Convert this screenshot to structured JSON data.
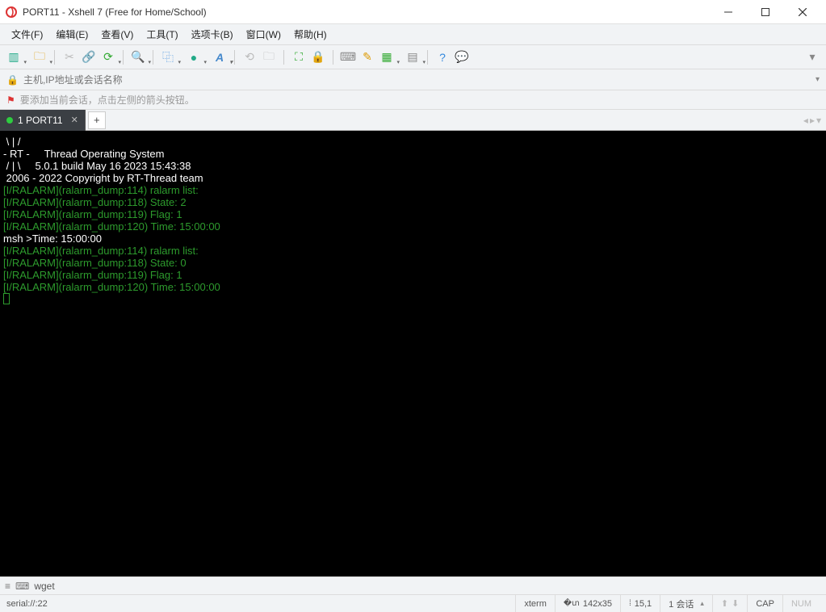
{
  "window": {
    "title": "PORT11 - Xshell 7 (Free for Home/School)"
  },
  "menu": {
    "file": "文件(F)",
    "edit": "编辑(E)",
    "view": "查看(V)",
    "tools": "工具(T)",
    "tabs": "选项卡(B)",
    "window": "窗口(W)",
    "help": "帮助(H)"
  },
  "addressbar": {
    "placeholder": "主机,IP地址或会话名称"
  },
  "hint": {
    "text": "要添加当前会话，点击左侧的箭头按钮。"
  },
  "tab": {
    "label": "1 PORT11"
  },
  "terminal": {
    "lines": [
      {
        "cls": "",
        "text": " \\ | /"
      },
      {
        "cls": "",
        "text": "- RT -     Thread Operating System"
      },
      {
        "cls": "",
        "text": " / | \\     5.0.1 build May 16 2023 15:43:38"
      },
      {
        "cls": "",
        "text": " 2006 - 2022 Copyright by RT-Thread team"
      },
      {
        "cls": "g",
        "text": "[I/RALARM](ralarm_dump:114) ralarm list:"
      },
      {
        "cls": "g",
        "text": "[I/RALARM](ralarm_dump:118) State: 2"
      },
      {
        "cls": "g",
        "text": "[I/RALARM](ralarm_dump:119) Flag: 1"
      },
      {
        "cls": "g",
        "text": "[I/RALARM](ralarm_dump:120) Time: 15:00:00"
      },
      {
        "cls": "",
        "text": "msh >Time: 15:00:00"
      },
      {
        "cls": "g",
        "text": "[I/RALARM](ralarm_dump:114) ralarm list:"
      },
      {
        "cls": "g",
        "text": "[I/RALARM](ralarm_dump:118) State: 0"
      },
      {
        "cls": "g",
        "text": "[I/RALARM](ralarm_dump:119) Flag: 1"
      },
      {
        "cls": "g",
        "text": "[I/RALARM](ralarm_dump:120) Time: 15:00:00"
      }
    ]
  },
  "bottom1": {
    "label": "wget"
  },
  "status": {
    "conn": "serial://:22",
    "term": "xterm",
    "size": "142x35",
    "pos": "15,1",
    "sessions": "1 会话",
    "cap": "CAP",
    "num": "NUM"
  }
}
